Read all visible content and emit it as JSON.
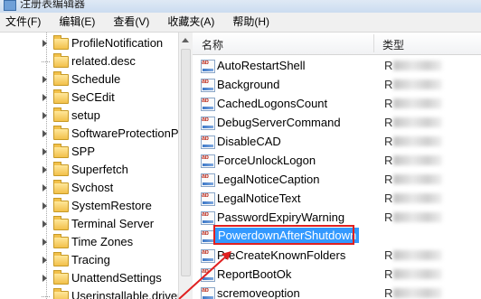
{
  "window": {
    "title": "注册表编辑器"
  },
  "menu": [
    {
      "label": "文件(F)"
    },
    {
      "label": "编辑(E)"
    },
    {
      "label": "查看(V)"
    },
    {
      "label": "收藏夹(A)"
    },
    {
      "label": "帮助(H)"
    }
  ],
  "tree": {
    "items": [
      {
        "label": "ProfileNotification",
        "expandable": true
      },
      {
        "label": "related.desc",
        "expandable": false
      },
      {
        "label": "Schedule",
        "expandable": true
      },
      {
        "label": "SeCEdit",
        "expandable": true
      },
      {
        "label": "setup",
        "expandable": true
      },
      {
        "label": "SoftwareProtectionPlatform",
        "expandable": true
      },
      {
        "label": "SPP",
        "expandable": true
      },
      {
        "label": "Superfetch",
        "expandable": true
      },
      {
        "label": "Svchost",
        "expandable": true
      },
      {
        "label": "SystemRestore",
        "expandable": true
      },
      {
        "label": "Terminal Server",
        "expandable": true
      },
      {
        "label": "Time Zones",
        "expandable": true
      },
      {
        "label": "Tracing",
        "expandable": true
      },
      {
        "label": "UnattendSettings",
        "expandable": true
      },
      {
        "label": "Userinstallable.drivers",
        "expandable": false
      }
    ]
  },
  "list": {
    "columns": {
      "name": "名称",
      "type": "类型"
    },
    "values": [
      {
        "name": "AutoRestartShell",
        "type": "R"
      },
      {
        "name": "Background",
        "type": "R"
      },
      {
        "name": "CachedLogonsCount",
        "type": "R"
      },
      {
        "name": "DebugServerCommand",
        "type": "R"
      },
      {
        "name": "DisableCAD",
        "type": "R"
      },
      {
        "name": "ForceUnlockLogon",
        "type": "R"
      },
      {
        "name": "LegalNoticeCaption",
        "type": "R"
      },
      {
        "name": "LegalNoticeText",
        "type": "R"
      },
      {
        "name": "PasswordExpiryWarning",
        "type": "R"
      },
      {
        "name": "PowerdownAfterShutdown",
        "type": "",
        "selected": true
      },
      {
        "name": "PreCreateKnownFolders",
        "type": "R"
      },
      {
        "name": "ReportBootOk",
        "type": "R"
      },
      {
        "name": "scremoveoption",
        "type": "R"
      }
    ],
    "icon_text": "ab"
  },
  "colors": {
    "selection": "#3399ff",
    "annotation": "#e02020"
  }
}
